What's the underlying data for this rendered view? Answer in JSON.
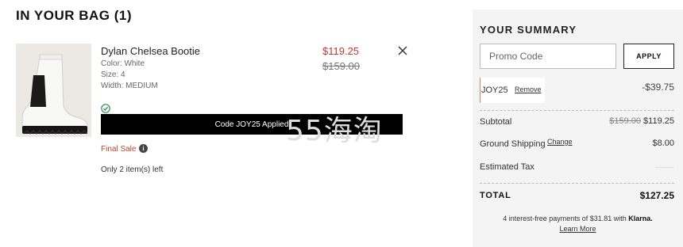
{
  "bag": {
    "title": "IN YOUR BAG (1)"
  },
  "item": {
    "name": "Dylan Chelsea Bootie",
    "color": "Color: White",
    "size": "Size: 4",
    "width": "Width: MEDIUM",
    "price_now": "$119.25",
    "price_was": "$159.00",
    "code_applied": "Code JOY25 Applied",
    "final_sale": "Final Sale",
    "info_glyph": "i",
    "stock": "Only 2 item(s) left",
    "icons": {
      "remove": "close-icon",
      "applied": "check-circle-icon",
      "info": "info-icon"
    }
  },
  "watermark": "55海淘",
  "summary": {
    "title": "YOUR SUMMARY",
    "promo_placeholder": "Promo Code",
    "apply_label": "APPLY",
    "applied_code": "JOY25",
    "remove_label": "Remove",
    "discount": "-$39.75",
    "subtotal_label": "Subtotal",
    "subtotal_was": "$159.00",
    "subtotal_now": "$119.25",
    "shipping_label": "Ground Shipping",
    "change_label": "Change",
    "shipping_value": "$8.00",
    "tax_label": "Estimated Tax",
    "total_label": "TOTAL",
    "total_value": "$127.25",
    "klarna_text": "4 interest-free payments of $31.81 with",
    "klarna_brand": "Klarna.",
    "learn_more": "Learn More"
  },
  "colors": {
    "sale_price": "#c0392b",
    "final_sale": "#b5452e",
    "check_green": "#2e8b57",
    "summary_bg": "#f4f4f4",
    "code_bar": "#000000"
  }
}
